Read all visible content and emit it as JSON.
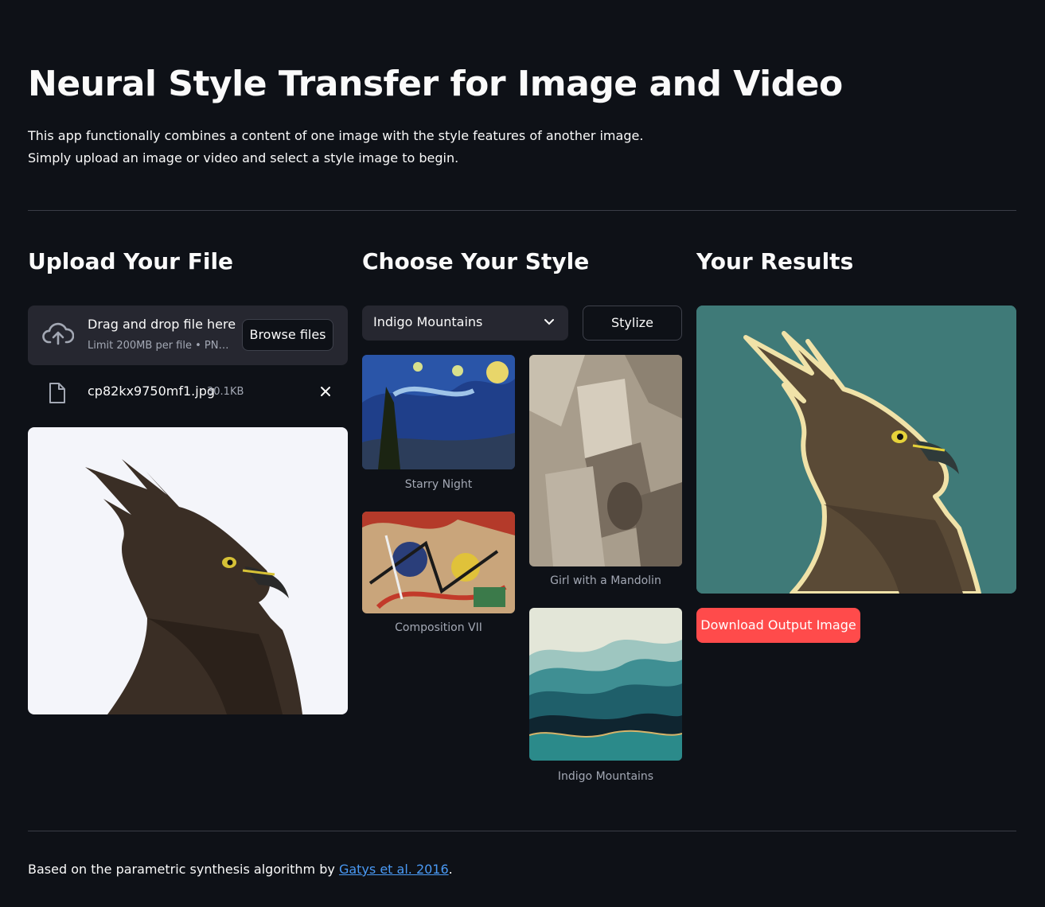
{
  "header": {
    "title": "Neural Style Transfer for Image and Video",
    "intro_line1": "This app functionally combines a content of one image with the style features of another image.",
    "intro_line2": "Simply upload an image or video and select a style image to begin."
  },
  "upload": {
    "heading": "Upload Your File",
    "drop_title": "Drag and drop file here",
    "drop_limit": "Limit 200MB per file • PN…",
    "browse_label": "Browse files",
    "file_name": "cp82kx9750mf1.jpg",
    "file_size": "30.1KB"
  },
  "style": {
    "heading": "Choose Your Style",
    "selected": "Indigo Mountains",
    "stylize_label": "Stylize",
    "gallery": [
      {
        "caption": "Starry Night"
      },
      {
        "caption": "Girl with a Mandolin"
      },
      {
        "caption": "Composition VII"
      },
      {
        "caption": "Indigo Mountains"
      }
    ]
  },
  "results": {
    "heading": "Your Results",
    "download_label": "Download Output Image"
  },
  "footer": {
    "prefix": "Based on the parametric synthesis algorithm by",
    "link_text": "Gatys et al. 2016",
    "suffix": "."
  },
  "colors": {
    "background": "#0e1117",
    "widget": "#262730",
    "primary": "#ff4b4b",
    "link": "#4a9af5"
  },
  "icons": [
    "cloud-upload-icon",
    "file-icon",
    "close-icon",
    "chevron-down-icon"
  ]
}
